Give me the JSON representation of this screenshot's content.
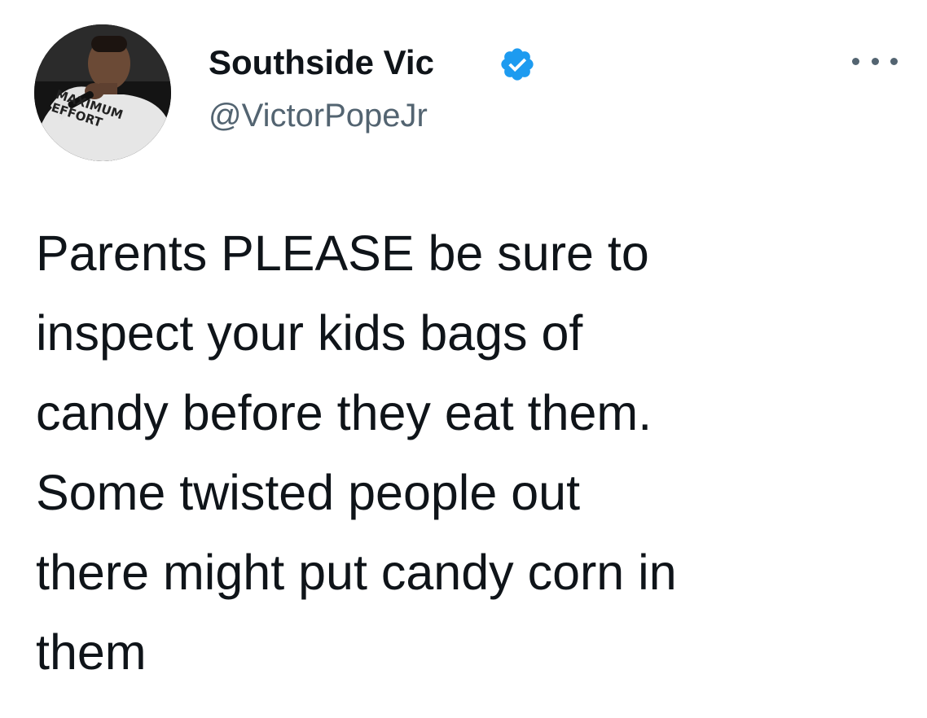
{
  "tweet": {
    "display_name": "Southside Vic",
    "handle": "@VictorPopeJr",
    "verified": true,
    "text": "Parents PLEASE be sure to\ninspect your kids bags of\ncandy before they eat them.\nSome twisted people out\nthere might put candy corn in\nthem",
    "avatar": {
      "shirt_text_line1": "MAXIMUM",
      "shirt_text_line2": "EFFORT"
    },
    "icons": {
      "verified": "verified-badge-icon",
      "more": "more-horizontal-icon"
    },
    "colors": {
      "text": "#0f1419",
      "secondary": "#536471",
      "verified_blue": "#1d9bf0",
      "background": "#ffffff"
    }
  }
}
